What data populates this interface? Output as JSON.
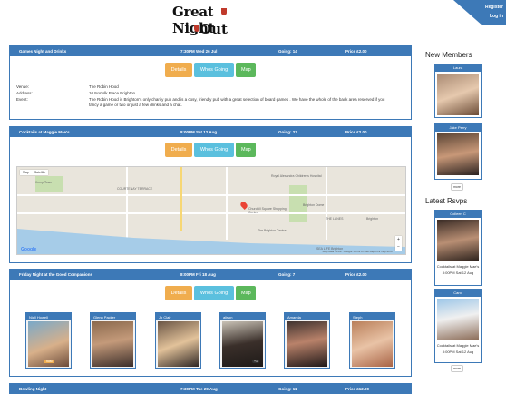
{
  "header": {
    "logo_line1": "Great Night",
    "logo_line2": "Out",
    "register": "Register",
    "login": "Log in"
  },
  "events": [
    {
      "title": "Games Night and Drinks",
      "when": "7:30PM Wed 26 Jul",
      "going": "Going: 14",
      "price": "Price £2.00",
      "details_label": "Details",
      "whos_going_label": "Whos Going",
      "map_label": "Map",
      "venue_label": "Venue:",
      "venue": "The Robin Hood",
      "address_label": "Address:",
      "address": "10 Norfolk Place Brighton",
      "event_label": "Event:",
      "description": "The Robin Hood is Brighton's only charity pub and is a cosy, friendly pub with a great selection of board games . We have the whole of the back area reserved if you fancy a game or two or just a few drinks and a chat."
    },
    {
      "title": "Cocktails at Maggie Mae's",
      "when": "8:00PM Sat 12 Aug",
      "going": "Going: 23",
      "price": "Price £2.00",
      "details_label": "Details",
      "whos_going_label": "Whos Going",
      "map_label": "Map",
      "map": {
        "tab_map": "Map",
        "tab_satellite": "Satellite",
        "logo": "Google",
        "attribution": "Map data ©2017 Google   Terms of Use   Report a map error",
        "places": [
          "Kemp Town",
          "COURTENAY TERRACE",
          "Churchill Square Shopping Centre",
          "Brighton Dome",
          "THE LANES",
          "The Brighton Centre",
          "SEA LIFE Brighton",
          "Brighton",
          "Royal Alexandra Children's Hospital"
        ]
      }
    },
    {
      "title": "Friday Night at the Good Companions",
      "when": "8:00PM Fri 18 Aug",
      "going": "Going: 7",
      "price": "Price £2.00",
      "details_label": "Details",
      "whos_going_label": "Whos Going",
      "map_label": "Map",
      "attendees": [
        {
          "name": "Niall Howell",
          "badge": "host"
        },
        {
          "name": "Glenn Packer",
          "badge": ""
        },
        {
          "name": "Jo Clair",
          "badge": ""
        },
        {
          "name": "alison",
          "badge": "+1"
        },
        {
          "name": "Amanda",
          "badge": ""
        },
        {
          "name": "Steph",
          "badge": ""
        }
      ]
    },
    {
      "title": "Bowling Night",
      "when": "7:30PM Tue 29 Aug",
      "going": "Going: 11",
      "price": "Price £12.00"
    }
  ],
  "sidebar": {
    "new_members_title": "New Members",
    "new_members": [
      {
        "name": "Laura"
      },
      {
        "name": "Jake Perry"
      }
    ],
    "more_label": "more",
    "latest_rsvps_title": "Latest Rsvps",
    "latest_rsvps": [
      {
        "name": "Colleen C",
        "event": "Cocktails at Maggie Mae's",
        "when": "8:00PM Sat 12 Aug"
      },
      {
        "name": "Carol",
        "event": "Cocktails at Maggie Mae's",
        "when": "8:00PM Sat 12 Aug"
      }
    ]
  },
  "colors": {
    "primary": "#3d79b7",
    "details": "#f0ad4e",
    "whos_going": "#5bc0de",
    "map": "#5cb85c"
  }
}
